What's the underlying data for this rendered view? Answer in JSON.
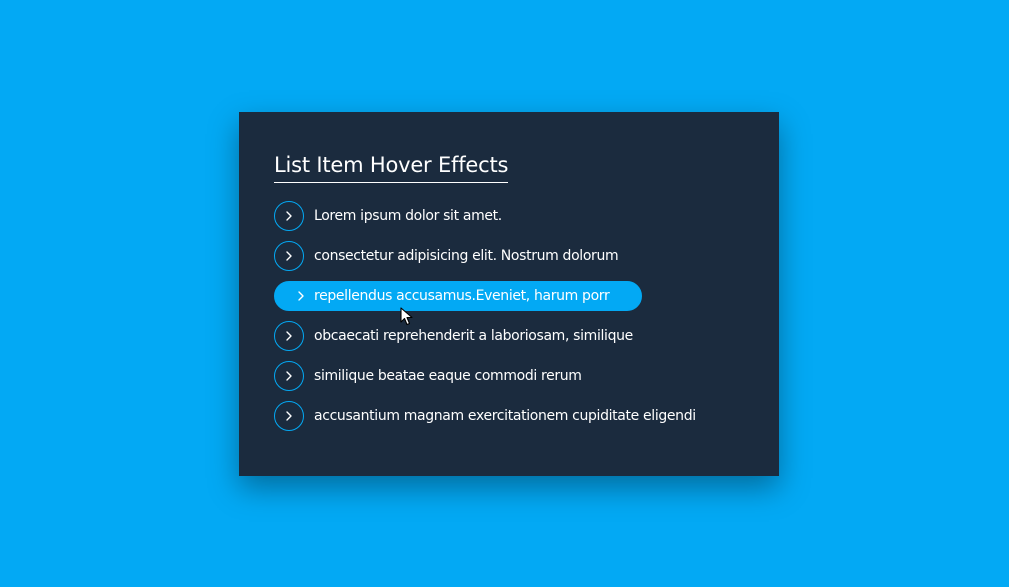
{
  "card": {
    "title": "List Item Hover Effects"
  },
  "list": {
    "items": [
      {
        "label": "Lorem ipsum dolor sit amet."
      },
      {
        "label": "consectetur adipisicing elit. Nostrum dolorum"
      },
      {
        "label": "repellendus accusamus.Eveniet, harum porr"
      },
      {
        "label": "obcaecati reprehenderit a laboriosam, similique"
      },
      {
        "label": "similique beatae eaque commodi rerum"
      },
      {
        "label": "accusantium magnam exercitationem cupiditate eligendi"
      }
    ],
    "hovered_index": 2
  },
  "icons": {
    "item_icon": "chevron-right-icon",
    "pointer": "mouse-cursor-icon"
  },
  "colors": {
    "background": "#03a9f4",
    "card": "#1b2b3e",
    "accent": "#03a9f4",
    "text": "#ffffff"
  }
}
